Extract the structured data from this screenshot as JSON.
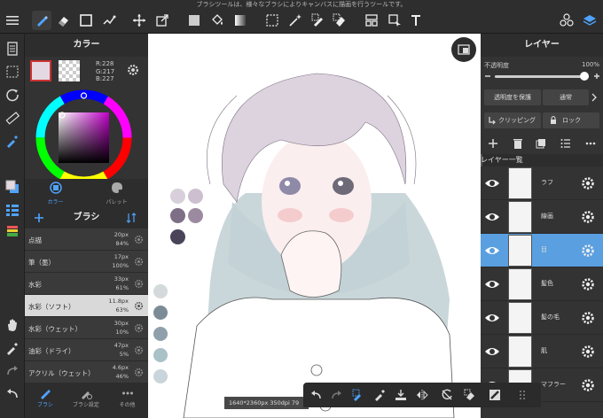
{
  "top_hint": "ブラシツールは、様々なブラシによりキャンバスに描画を行うツールです。",
  "toolbar": {
    "icons": [
      "menu-icon",
      "brush-icon",
      "eraser-icon",
      "shape-icon",
      "pen-icon",
      "move-icon",
      "transform-icon",
      "fill-square-icon",
      "bucket-icon",
      "gradient-icon",
      "select-icon",
      "magic-wand-icon",
      "select-pen-icon",
      "select-eraser-icon",
      "panel-icon",
      "crop-icon",
      "text-icon",
      "materials-icon",
      "layers-icon"
    ]
  },
  "color_panel": {
    "title": "カラー",
    "r": "R:228",
    "g": "G:217",
    "b": "B:227",
    "primary": "#e4d9e3",
    "tabs": [
      "カラー",
      "パレット"
    ]
  },
  "brush_panel": {
    "title": "ブラシ",
    "items": [
      {
        "name": "点描",
        "size": "20px",
        "opacity": "84%"
      },
      {
        "name": "筆（墨）",
        "size": "17px",
        "opacity": "100%"
      },
      {
        "name": "水彩",
        "size": "33px",
        "opacity": "61%"
      },
      {
        "name": "水彩（ソフト）",
        "size": "11.8px",
        "opacity": "63%"
      },
      {
        "name": "水彩（ウェット）",
        "size": "30px",
        "opacity": "10%"
      },
      {
        "name": "油彩（ドライ）",
        "size": "47px",
        "opacity": "5%"
      },
      {
        "name": "アクリル（ウェット）",
        "size": "4.6px",
        "opacity": "46%"
      }
    ],
    "tabs": [
      "ブラシ",
      "ブラシ設定",
      "その他"
    ]
  },
  "layer_panel": {
    "title": "レイヤー",
    "opacity_label": "不透明度",
    "opacity_value": "100%",
    "opacity_level": 1.0,
    "protect_label": "透明度を保護",
    "blend_label": "通常",
    "clipping_label": "クリッピング",
    "lock_label": "ロック",
    "folder_label": "レイヤー一覧",
    "layers": [
      {
        "name": "ラフ"
      },
      {
        "name": "線画"
      },
      {
        "name": "目"
      },
      {
        "name": "髪色"
      },
      {
        "name": "髪の毛"
      },
      {
        "name": "肌"
      },
      {
        "name": "マフラー"
      }
    ]
  },
  "status": "1640*2360px 350dpi 79",
  "palette_swatches": [
    "#d7cfd9",
    "#cdbfd0",
    "#7d6f86",
    "#9c8ba0",
    "#4a4458",
    "#d4d9dc",
    "#7c8c96",
    "#8fa0ab",
    "#a9c1c7",
    "#c9d5da"
  ]
}
